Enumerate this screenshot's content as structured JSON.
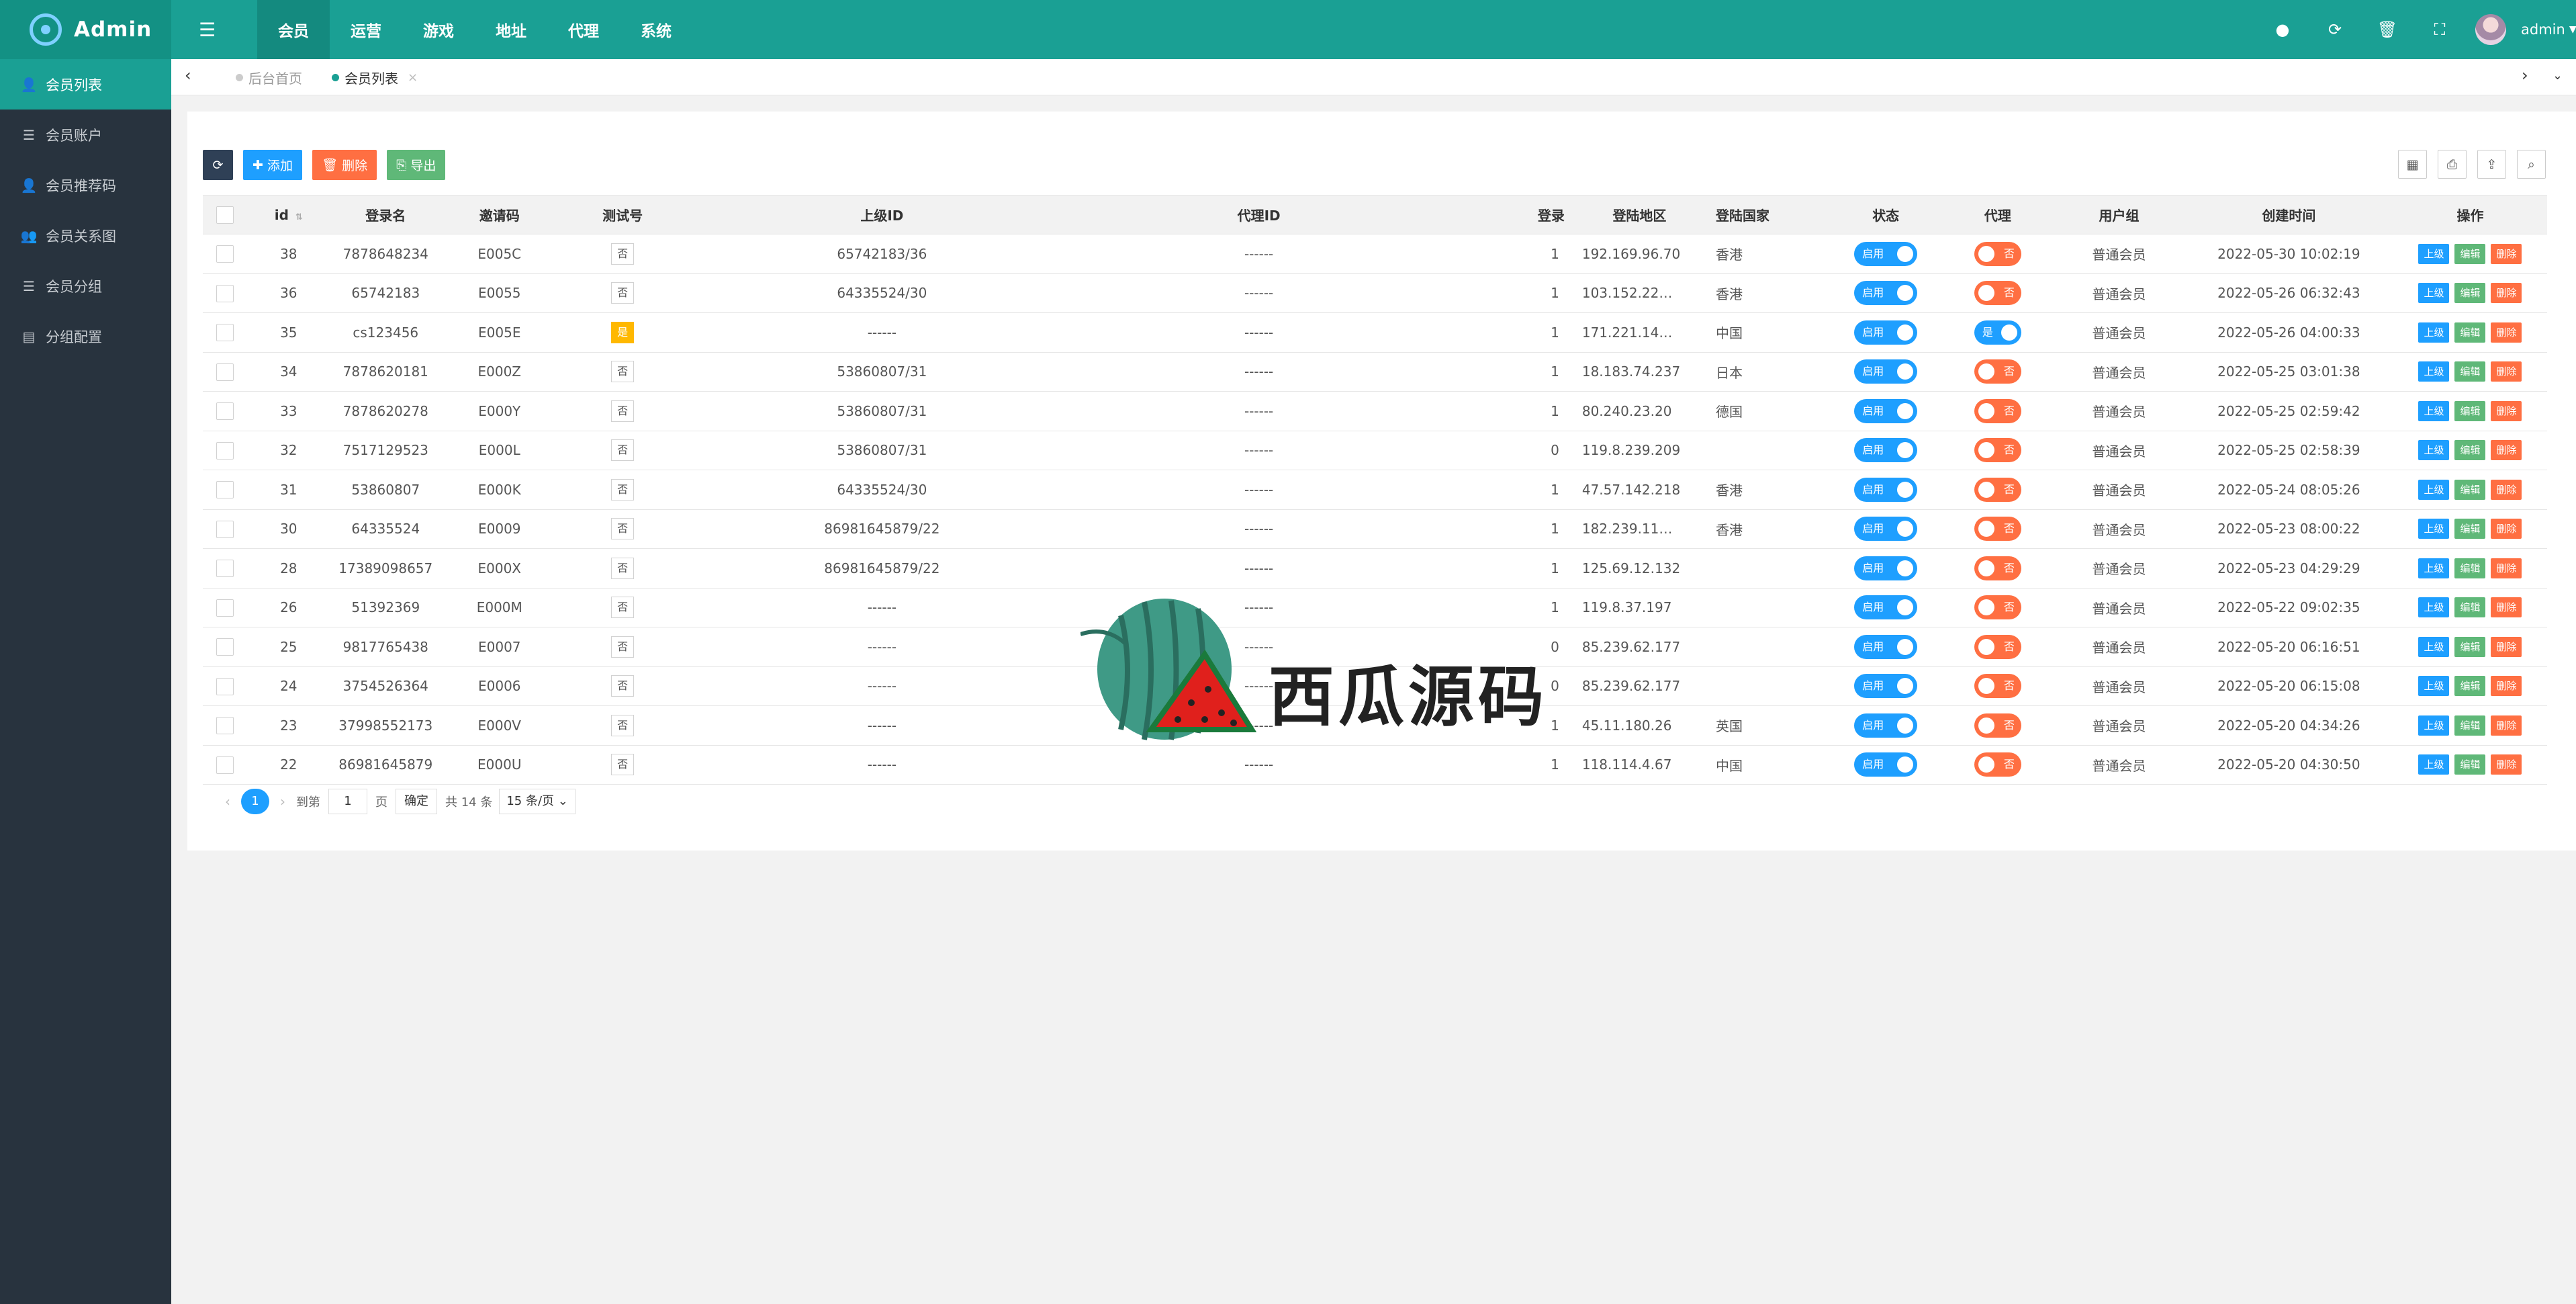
{
  "header": {
    "app_name": "Admin",
    "nav": [
      "会员",
      "运营",
      "游戏",
      "地址",
      "代理",
      "系统"
    ],
    "active_nav": 0,
    "user_name": "admin"
  },
  "sidebar": {
    "items": [
      {
        "label": "会员列表",
        "icon": "user-icon",
        "active": true
      },
      {
        "label": "会员账户",
        "icon": "list-icon"
      },
      {
        "label": "会员推荐码",
        "icon": "user-plus-icon"
      },
      {
        "label": "会员关系图",
        "icon": "users-icon"
      },
      {
        "label": "会员分组",
        "icon": "list-icon"
      },
      {
        "label": "分组配置",
        "icon": "file-icon"
      }
    ]
  },
  "tabs": [
    {
      "label": "后台首页",
      "active": false
    },
    {
      "label": "会员列表",
      "active": true,
      "close": "×"
    }
  ],
  "toolbar": {
    "add": "添加",
    "delete": "删除",
    "export": "导出"
  },
  "table": {
    "headers": [
      "id",
      "登录名",
      "邀请码",
      "测试号",
      "上级ID",
      "代理ID",
      "登录",
      "登陆地区",
      "登陆国家",
      "状态",
      "代理",
      "用户组",
      "创建时间",
      "操作"
    ],
    "rows": [
      {
        "id": "38",
        "login": "7878648234",
        "invite": "E005C",
        "test": "否",
        "parent": "65742183/36",
        "agent": "------",
        "logins": "1",
        "ip": "192.169.96.70",
        "country": "香港",
        "status": "启用",
        "proxy": "否",
        "group": "普通会员",
        "created": "2022-05-30 10:02:19"
      },
      {
        "id": "36",
        "login": "65742183",
        "invite": "E0055",
        "test": "否",
        "parent": "64335524/30",
        "agent": "------",
        "logins": "1",
        "ip": "103.152.22…",
        "country": "香港",
        "status": "启用",
        "proxy": "否",
        "group": "普通会员",
        "created": "2022-05-26 06:32:43"
      },
      {
        "id": "35",
        "login": "cs123456",
        "invite": "E005E",
        "test": "是",
        "parent": "------",
        "agent": "------",
        "logins": "1",
        "ip": "171.221.14…",
        "country": "中国",
        "status": "启用",
        "proxy": "是",
        "group": "普通会员",
        "created": "2022-05-26 04:00:33"
      },
      {
        "id": "34",
        "login": "7878620181",
        "invite": "E000Z",
        "test": "否",
        "parent": "53860807/31",
        "agent": "------",
        "logins": "1",
        "ip": "18.183.74.237",
        "country": "日本",
        "status": "启用",
        "proxy": "否",
        "group": "普通会员",
        "created": "2022-05-25 03:01:38"
      },
      {
        "id": "33",
        "login": "7878620278",
        "invite": "E000Y",
        "test": "否",
        "parent": "53860807/31",
        "agent": "------",
        "logins": "1",
        "ip": "80.240.23.20",
        "country": "德国",
        "status": "启用",
        "proxy": "否",
        "group": "普通会员",
        "created": "2022-05-25 02:59:42"
      },
      {
        "id": "32",
        "login": "7517129523",
        "invite": "E000L",
        "test": "否",
        "parent": "53860807/31",
        "agent": "------",
        "logins": "0",
        "ip": "119.8.239.209",
        "country": "",
        "status": "启用",
        "proxy": "否",
        "group": "普通会员",
        "created": "2022-05-25 02:58:39"
      },
      {
        "id": "31",
        "login": "53860807",
        "invite": "E000K",
        "test": "否",
        "parent": "64335524/30",
        "agent": "------",
        "logins": "1",
        "ip": "47.57.142.218",
        "country": "香港",
        "status": "启用",
        "proxy": "否",
        "group": "普通会员",
        "created": "2022-05-24 08:05:26"
      },
      {
        "id": "30",
        "login": "64335524",
        "invite": "E0009",
        "test": "否",
        "parent": "86981645879/22",
        "agent": "------",
        "logins": "1",
        "ip": "182.239.11…",
        "country": "香港",
        "status": "启用",
        "proxy": "否",
        "group": "普通会员",
        "created": "2022-05-23 08:00:22"
      },
      {
        "id": "28",
        "login": "17389098657",
        "invite": "E000X",
        "test": "否",
        "parent": "86981645879/22",
        "agent": "------",
        "logins": "1",
        "ip": "125.69.12.132",
        "country": "",
        "status": "启用",
        "proxy": "否",
        "group": "普通会员",
        "created": "2022-05-23 04:29:29"
      },
      {
        "id": "26",
        "login": "51392369",
        "invite": "E000M",
        "test": "否",
        "parent": "------",
        "agent": "------",
        "logins": "1",
        "ip": "119.8.37.197",
        "country": "",
        "status": "启用",
        "proxy": "否",
        "group": "普通会员",
        "created": "2022-05-22 09:02:35"
      },
      {
        "id": "25",
        "login": "9817765438",
        "invite": "E0007",
        "test": "否",
        "parent": "------",
        "agent": "------",
        "logins": "0",
        "ip": "85.239.62.177",
        "country": "",
        "status": "启用",
        "proxy": "否",
        "group": "普通会员",
        "created": "2022-05-20 06:16:51"
      },
      {
        "id": "24",
        "login": "3754526364",
        "invite": "E0006",
        "test": "否",
        "parent": "------",
        "agent": "------",
        "logins": "0",
        "ip": "85.239.62.177",
        "country": "",
        "status": "启用",
        "proxy": "否",
        "group": "普通会员",
        "created": "2022-05-20 06:15:08"
      },
      {
        "id": "23",
        "login": "37998552173",
        "invite": "E000V",
        "test": "否",
        "parent": "------",
        "agent": "------",
        "logins": "1",
        "ip": "45.11.180.26",
        "country": "英国",
        "status": "启用",
        "proxy": "否",
        "group": "普通会员",
        "created": "2022-05-20 04:34:26"
      },
      {
        "id": "22",
        "login": "86981645879",
        "invite": "E000U",
        "test": "否",
        "parent": "------",
        "agent": "------",
        "logins": "1",
        "ip": "118.114.4.67",
        "country": "中国",
        "status": "启用",
        "proxy": "否",
        "group": "普通会员",
        "created": "2022-05-20 04:30:50"
      }
    ],
    "actions": {
      "up": "上级",
      "edit": "编辑",
      "del": "删除"
    }
  },
  "pager": {
    "current": "1",
    "goto": "到第",
    "page_value": "1",
    "page": "页",
    "confirm": "确定",
    "total": "共 14 条",
    "size": "15 条/页"
  },
  "watermark": {
    "text": "西瓜源码"
  },
  "colors": {
    "header": "#1aa094",
    "sidebar": "#28333e",
    "blue": "#1e9fff",
    "green": "#5fb878",
    "red": "#ff5722"
  }
}
